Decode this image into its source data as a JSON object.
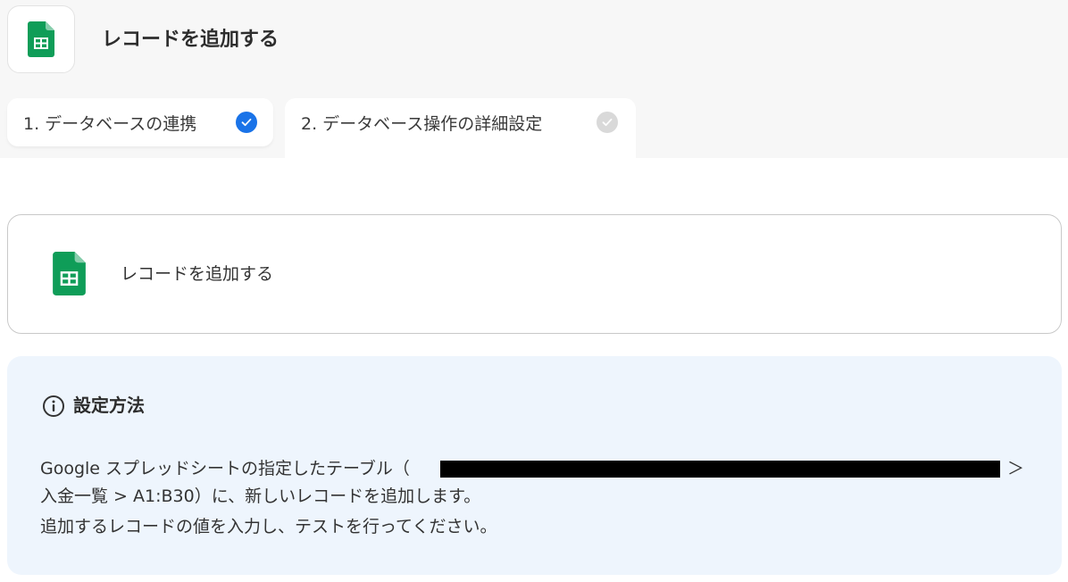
{
  "header": {
    "icon": "google-sheets-icon",
    "title": "レコードを追加する"
  },
  "tabs": [
    {
      "label": "1. データベースの連携",
      "completed": true,
      "status_icon": "check-circle-icon"
    },
    {
      "label": "2. データベース操作の詳細設定",
      "completed": false,
      "status_icon": "check-circle-icon"
    }
  ],
  "action_card": {
    "icon": "google-sheets-icon",
    "title": "レコードを追加する"
  },
  "info": {
    "icon": "info-circle-icon",
    "title": "設定方法",
    "line1_prefix": "Google スプレッドシートの指定したテーブル（",
    "line1_suffix": "＞",
    "line2": "入金一覧 > A1:B30）に、新しいレコードを追加します。",
    "line3": "追加するレコードの値を入力し、テストを行ってください。"
  },
  "colors": {
    "accent": "#1a73e8",
    "sheets_green": "#0f9d58",
    "info_bg": "#eef5fd",
    "inactive_check": "#d9d9d9"
  }
}
